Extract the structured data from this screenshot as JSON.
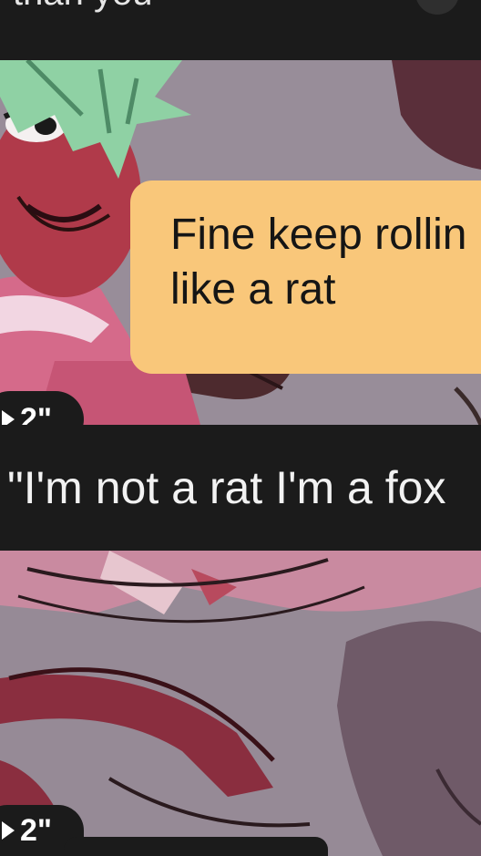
{
  "top_caption": {
    "text": "than you"
  },
  "speech_bubble": {
    "lines": [
      "Fine keep rollin",
      "like a rat"
    ]
  },
  "clips": [
    {
      "duration": "2\""
    },
    {
      "duration": "2\""
    }
  ],
  "caption": {
    "text": "\"I'm not a rat I'm a fox"
  },
  "colors": {
    "bar_background": "#1b1b1b",
    "bubble": "#f9c77a",
    "panel_background": "#8f8590",
    "character_red": "#b03a4a",
    "hair_green": "#8fd1a4"
  },
  "icons": [
    "play-icon"
  ]
}
